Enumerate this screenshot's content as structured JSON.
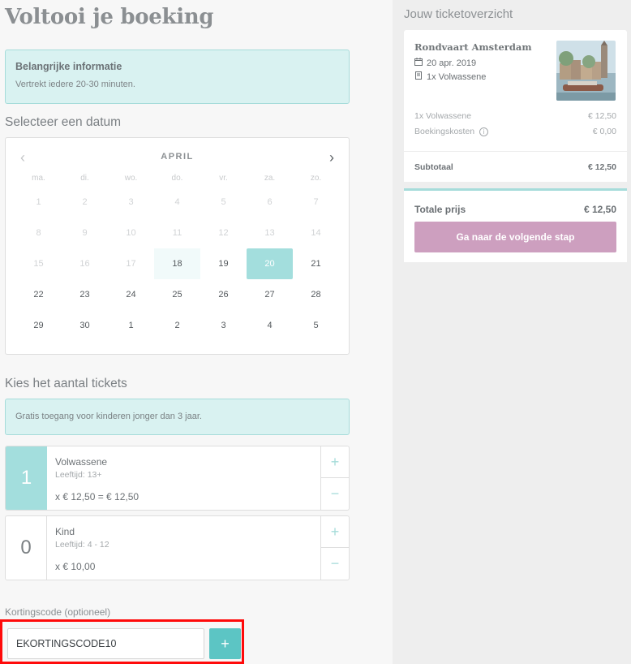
{
  "page": {
    "title": "Voltooi je boeking"
  },
  "info": {
    "title": "Belangrijke informatie",
    "text": "Vertrekt iedere 20-30 minuten."
  },
  "date_section": {
    "heading": "Selecteer een datum"
  },
  "calendar": {
    "month": "APRIL",
    "prev_icon": "chevron-left-icon",
    "next_icon": "chevron-right-icon",
    "weekdays": [
      "ma.",
      "di.",
      "wo.",
      "do.",
      "vr.",
      "za.",
      "zo."
    ],
    "weeks": [
      [
        {
          "d": "1",
          "s": "dis"
        },
        {
          "d": "2",
          "s": "dis"
        },
        {
          "d": "3",
          "s": "dis"
        },
        {
          "d": "4",
          "s": "dis"
        },
        {
          "d": "5",
          "s": "dis"
        },
        {
          "d": "6",
          "s": "dis"
        },
        {
          "d": "7",
          "s": "dis"
        }
      ],
      [
        {
          "d": "8",
          "s": "dis"
        },
        {
          "d": "9",
          "s": "dis"
        },
        {
          "d": "10",
          "s": "dis"
        },
        {
          "d": "11",
          "s": "dis"
        },
        {
          "d": "12",
          "s": "dis"
        },
        {
          "d": "13",
          "s": "dis"
        },
        {
          "d": "14",
          "s": "dis"
        }
      ],
      [
        {
          "d": "15",
          "s": "dis"
        },
        {
          "d": "16",
          "s": "dis"
        },
        {
          "d": "17",
          "s": "dis"
        },
        {
          "d": "18",
          "s": "hl"
        },
        {
          "d": "19",
          "s": ""
        },
        {
          "d": "20",
          "s": "sel"
        },
        {
          "d": "21",
          "s": ""
        }
      ],
      [
        {
          "d": "22",
          "s": ""
        },
        {
          "d": "23",
          "s": ""
        },
        {
          "d": "24",
          "s": ""
        },
        {
          "d": "25",
          "s": ""
        },
        {
          "d": "26",
          "s": ""
        },
        {
          "d": "27",
          "s": ""
        },
        {
          "d": "28",
          "s": ""
        }
      ],
      [
        {
          "d": "29",
          "s": ""
        },
        {
          "d": "30",
          "s": ""
        },
        {
          "d": "1",
          "s": ""
        },
        {
          "d": "2",
          "s": ""
        },
        {
          "d": "3",
          "s": ""
        },
        {
          "d": "4",
          "s": ""
        },
        {
          "d": "5",
          "s": ""
        }
      ]
    ],
    "selected_day": "20"
  },
  "tickets_section": {
    "heading": "Kies het aantal tickets",
    "tip": "Gratis toegang voor kinderen jonger dan 3 jaar."
  },
  "tickets": [
    {
      "qty": "1",
      "name": "Volwassene",
      "age": "Leeftijd: 13+",
      "price": "x € 12,50 = € 12,50",
      "plus": "+",
      "minus": "−"
    },
    {
      "qty": "0",
      "name": "Kind",
      "age": "Leeftijd: 4 - 12",
      "price": "x € 10,00",
      "plus": "+",
      "minus": "−"
    }
  ],
  "discount": {
    "label": "Kortingscode (optioneel)",
    "value": "EKORTINGSCODE10",
    "button": "+"
  },
  "summary": {
    "heading": "Jouw ticketoverzicht",
    "tour_name": "Rondvaart Amsterdam",
    "date": "20 apr. 2019",
    "tickets": "1x Volwassene",
    "calendar_icon": "calendar-icon",
    "ticket_icon": "ticket-icon",
    "lines": [
      {
        "label": "1x Volwassene",
        "value": "€ 12,50"
      },
      {
        "label": "Boekingskosten",
        "value": "€ 0,00"
      }
    ],
    "subtotal_label": "Subtotaal",
    "subtotal_value": "€ 12,50",
    "total_label": "Totale prijs",
    "total_value": "€ 12,50",
    "next_button": "Ga naar de volgende stap"
  },
  "colors": {
    "accent": "#5cc5c4",
    "accent_light": "#a3dedd",
    "cta": "#cd9fbf",
    "highlight": "#ff0a0a"
  }
}
